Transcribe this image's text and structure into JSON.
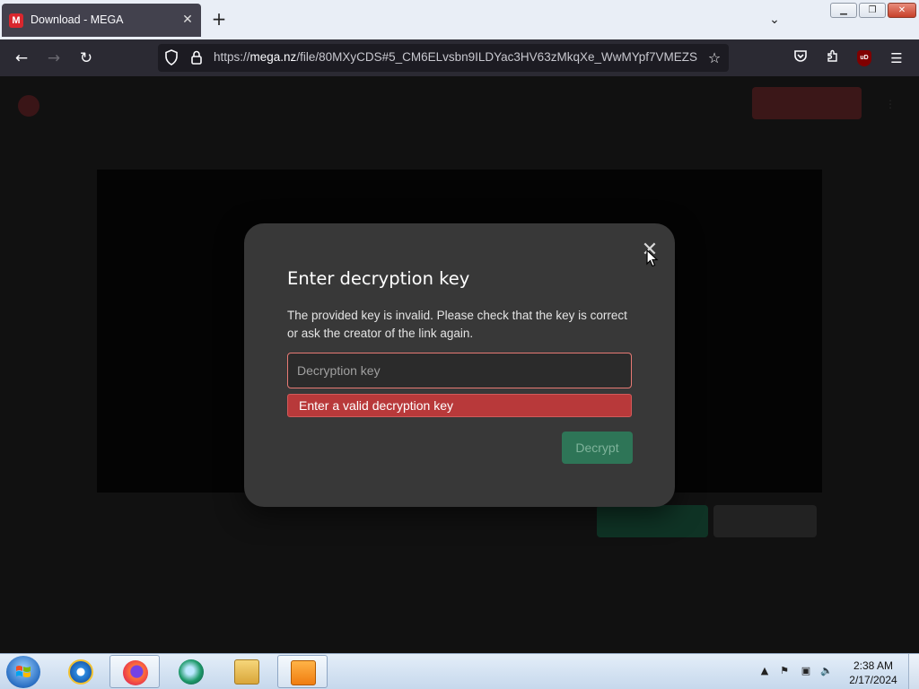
{
  "browser": {
    "tab": {
      "title": "Download - MEGA",
      "favicon_letter": "M",
      "favicon_color": "#d9272e"
    },
    "new_tab_label": "+",
    "url": {
      "scheme": "https://",
      "host": "mega.nz",
      "path": "/file/80MXyCDS#5_CM6ELvsbn9ILDYac3HV63zMkqXe_WwMYpf7VMEZS"
    },
    "extension_badge": "uD"
  },
  "page": {
    "brand_color": "#d9272e"
  },
  "dialog": {
    "title": "Enter decryption key",
    "description": "The provided key is invalid. Please check that the key is correct or ask the creator of the link again.",
    "input": {
      "placeholder": "Decryption key",
      "value": ""
    },
    "error": "Enter a valid decryption key",
    "decrypt_label": "Decrypt",
    "close_glyph": "✕",
    "accent_color": "#2e7557",
    "error_color": "#b8393a"
  },
  "taskbar": {
    "apps": [
      {
        "name": "internet-explorer-icon"
      },
      {
        "name": "firefox-icon",
        "active": true
      },
      {
        "name": "app-icon"
      },
      {
        "name": "file-explorer-icon"
      },
      {
        "name": "media-player-icon"
      }
    ],
    "clock": {
      "time": "2:38 AM",
      "date": "2/17/2024"
    }
  }
}
